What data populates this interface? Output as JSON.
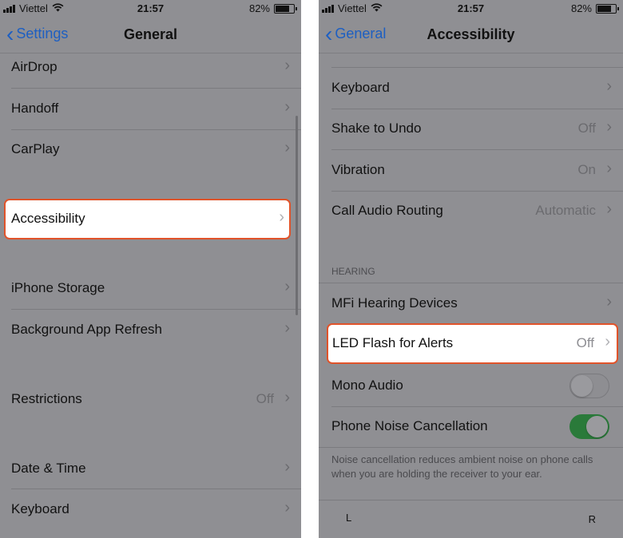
{
  "status": {
    "carrier": "Viettel",
    "time": "21:57",
    "battery": "82%"
  },
  "left": {
    "nav": {
      "back": "Settings",
      "title": "General"
    },
    "rows": [
      "AirDrop",
      "Handoff",
      "CarPlay"
    ],
    "accessibility": "Accessibility",
    "rows2": [
      "iPhone Storage",
      "Background App Refresh"
    ],
    "restrictions": {
      "label": "Restrictions",
      "value": "Off"
    },
    "rows3": [
      "Date & Time",
      "Keyboard"
    ]
  },
  "right": {
    "nav": {
      "back": "General",
      "title": "Accessibility"
    },
    "keyboard": "Keyboard",
    "shake": {
      "label": "Shake to Undo",
      "value": "Off"
    },
    "vibration": {
      "label": "Vibration",
      "value": "On"
    },
    "call_audio": {
      "label": "Call Audio Routing",
      "value": "Automatic"
    },
    "hearing_header": "HEARING",
    "mfi": "MFi Hearing Devices",
    "led": {
      "label": "LED Flash for Alerts",
      "value": "Off"
    },
    "mono": {
      "label": "Mono Audio",
      "state": "off"
    },
    "noise": {
      "label": "Phone Noise Cancellation",
      "state": "on"
    },
    "noise_footer": "Noise cancellation reduces ambient noise on phone calls when you are holding the receiver to your ear.",
    "balance_left": "L",
    "balance_right": "R"
  },
  "colors": {
    "accent": "#1d5fc2",
    "highlight_border": "#e0532a",
    "toggle_on": "#2a7a3a"
  }
}
